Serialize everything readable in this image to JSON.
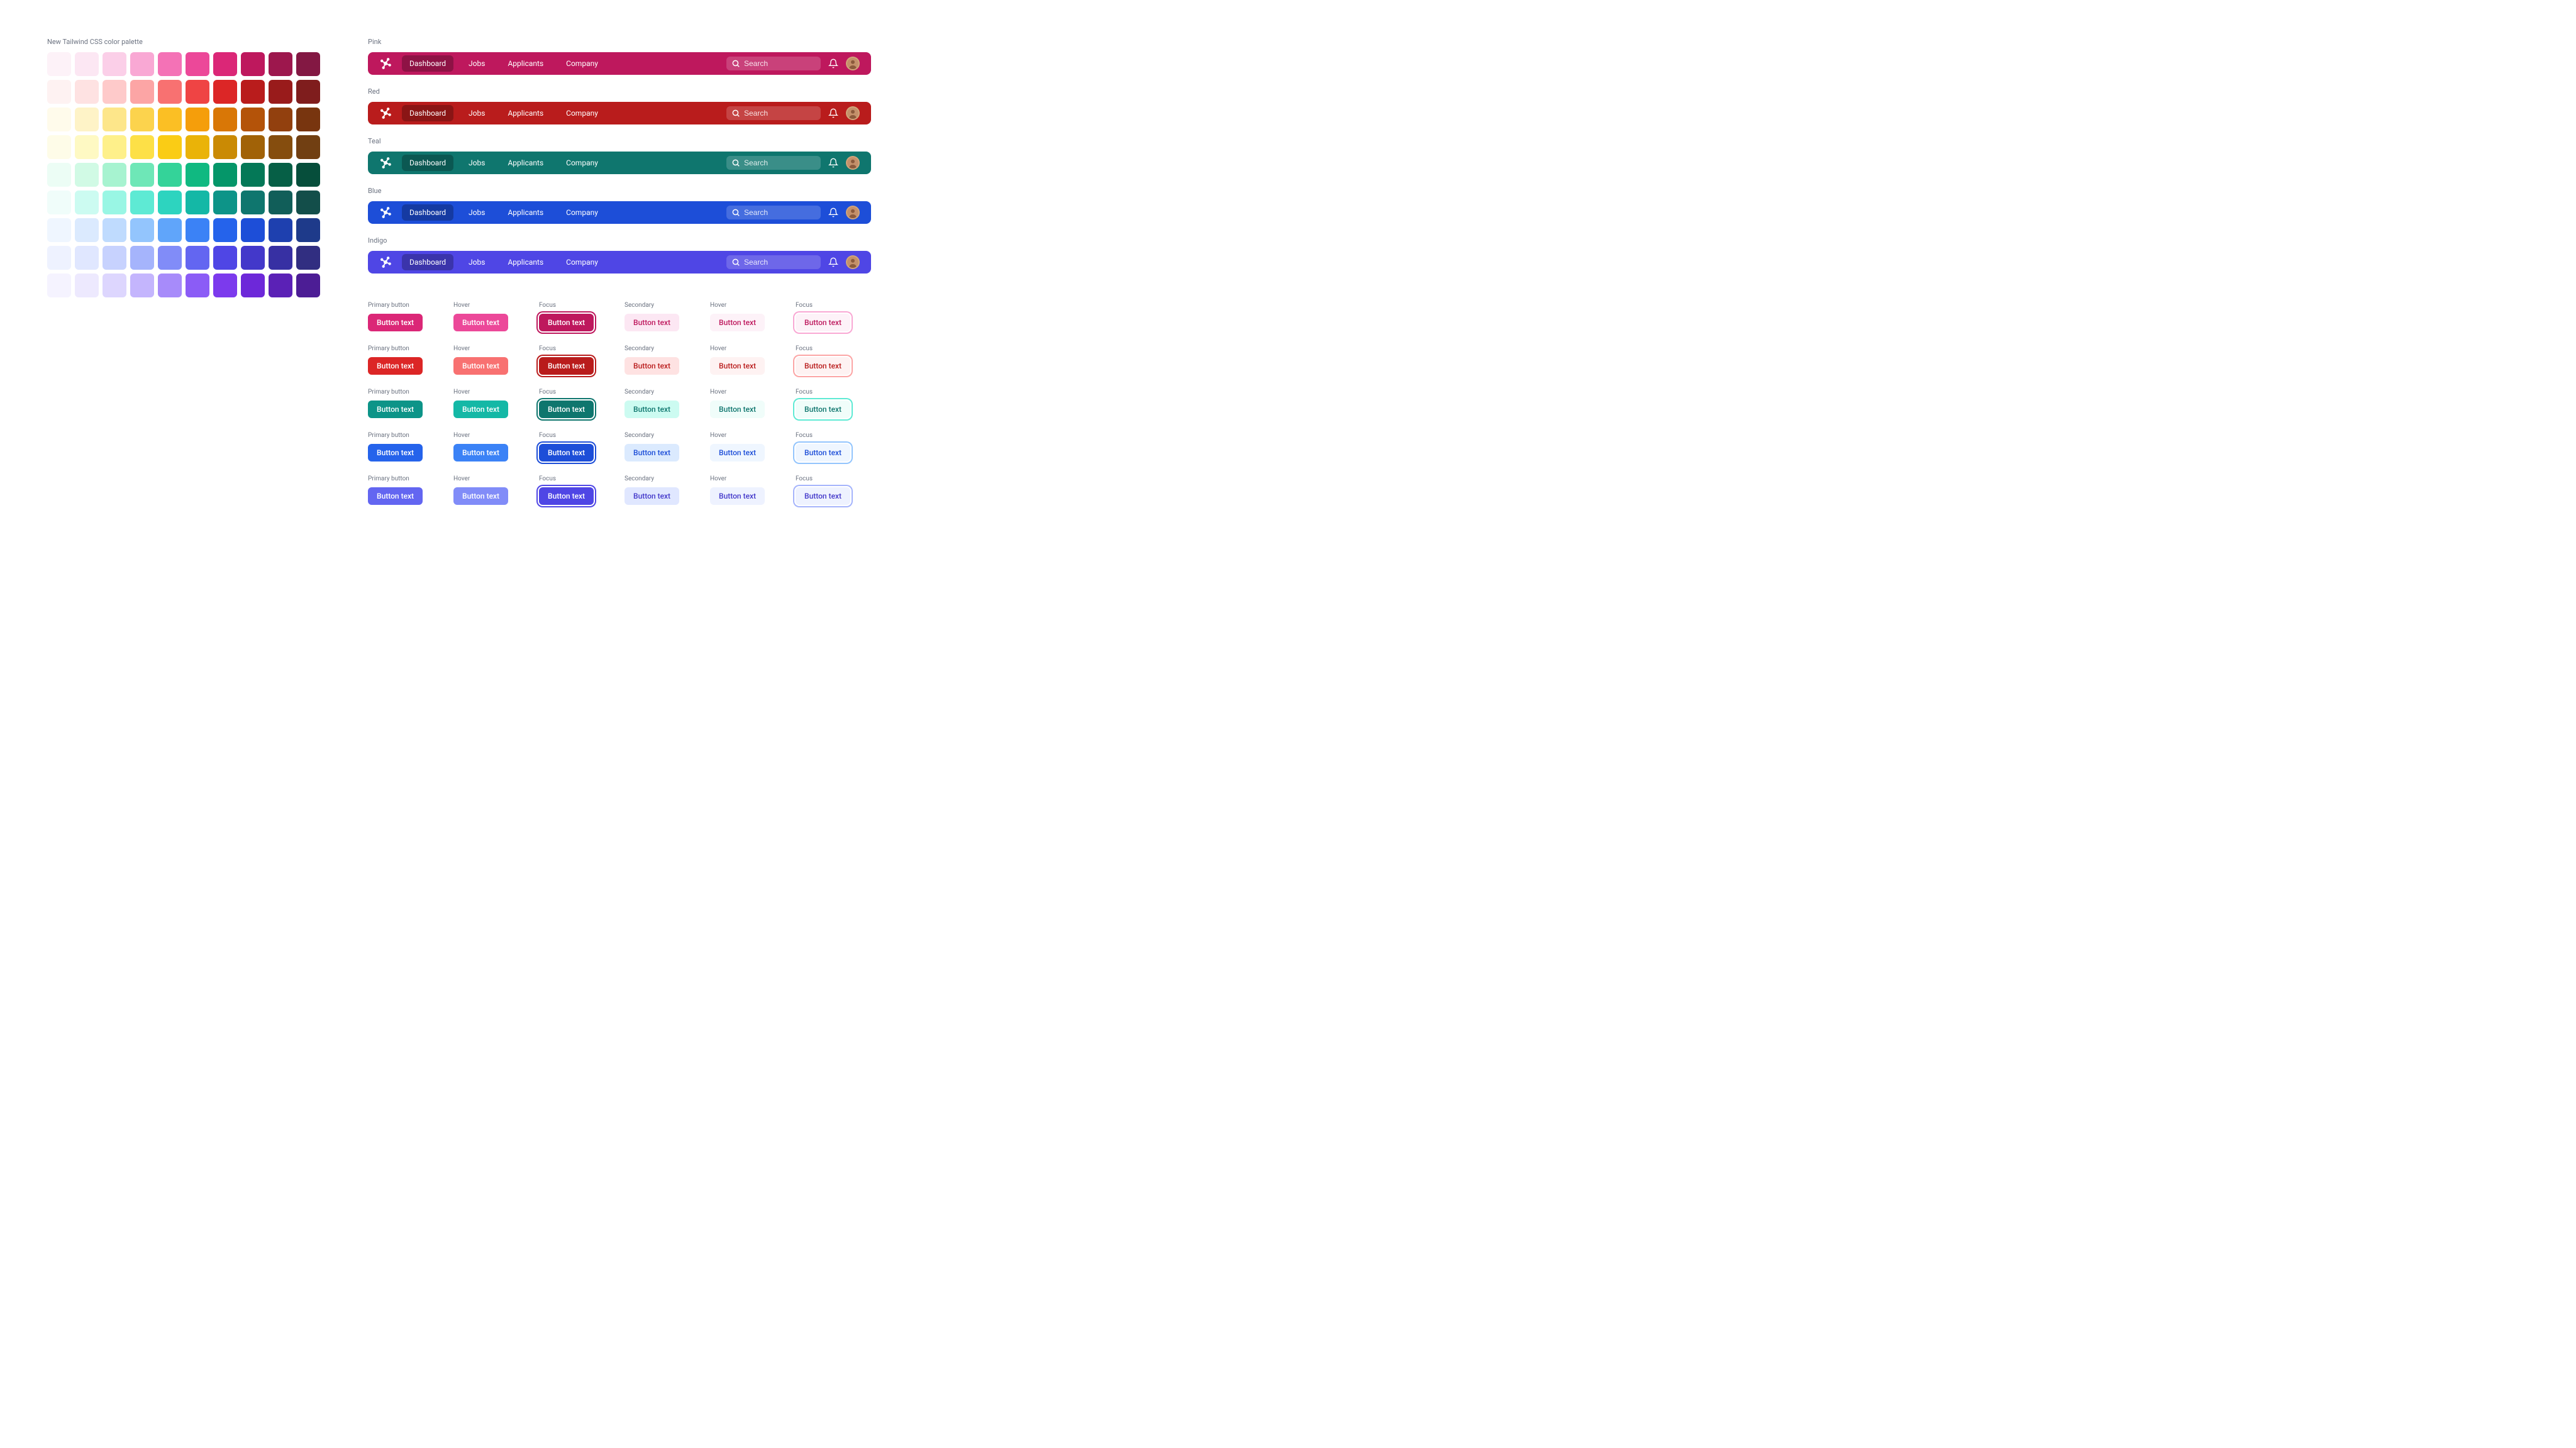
{
  "paletteTitle": "New Tailwind CSS color palette",
  "paletteRows": [
    [
      "#fdf2f8",
      "#fce7f3",
      "#fbcfe8",
      "#f9a8d4",
      "#f472b6",
      "#ec4899",
      "#db2777",
      "#be185d",
      "#9d174d",
      "#831843"
    ],
    [
      "#fef2f2",
      "#fee2e2",
      "#fecaca",
      "#fca5a5",
      "#f87171",
      "#ef4444",
      "#dc2626",
      "#b91c1c",
      "#991b1b",
      "#7f1d1d"
    ],
    [
      "#fffbeb",
      "#fef3c7",
      "#fde68a",
      "#fcd34d",
      "#fbbf24",
      "#f59e0b",
      "#d97706",
      "#b45309",
      "#92400e",
      "#78350f"
    ],
    [
      "#fefce8",
      "#fef9c3",
      "#fef08a",
      "#fde047",
      "#facc15",
      "#eab308",
      "#ca8a04",
      "#a16207",
      "#854d0e",
      "#713f12"
    ],
    [
      "#ecfdf5",
      "#d1fae5",
      "#a7f3d0",
      "#6ee7b7",
      "#34d399",
      "#10b981",
      "#059669",
      "#047857",
      "#065f46",
      "#064e3b"
    ],
    [
      "#f0fdfa",
      "#ccfbf1",
      "#99f6e4",
      "#5eead4",
      "#2dd4bf",
      "#14b8a6",
      "#0d9488",
      "#0f766e",
      "#115e59",
      "#134e4a"
    ],
    [
      "#eff6ff",
      "#dbeafe",
      "#bfdbfe",
      "#93c5fd",
      "#60a5fa",
      "#3b82f6",
      "#2563eb",
      "#1d4ed8",
      "#1e40af",
      "#1e3a8a"
    ],
    [
      "#eef2ff",
      "#e0e7ff",
      "#c7d2fe",
      "#a5b4fc",
      "#818cf8",
      "#6366f1",
      "#4f46e5",
      "#4338ca",
      "#3730a3",
      "#312e81"
    ],
    [
      "#f5f3ff",
      "#ede9fe",
      "#ddd6fe",
      "#c4b5fd",
      "#a78bfa",
      "#8b5cf6",
      "#7c3aed",
      "#6d28d9",
      "#5b21b6",
      "#4c1d95"
    ]
  ],
  "navbars": [
    {
      "label": "Pink",
      "bg": "#be185d"
    },
    {
      "label": "Red",
      "bg": "#b91c1c"
    },
    {
      "label": "Teal",
      "bg": "#0f766e"
    },
    {
      "label": "Blue",
      "bg": "#1d4ed8"
    },
    {
      "label": "Indigo",
      "bg": "#4f46e5"
    }
  ],
  "nav": {
    "items": [
      "Dashboard",
      "Jobs",
      "Applicants",
      "Company"
    ],
    "activeIndex": 0,
    "searchPlaceholder": "Search"
  },
  "buttonStates": [
    {
      "label": "Primary button",
      "kind": "primary"
    },
    {
      "label": "Hover",
      "kind": "primary-hover"
    },
    {
      "label": "Focus",
      "kind": "primary-focus"
    },
    {
      "label": "Secondary",
      "kind": "secondary"
    },
    {
      "label": "Hover",
      "kind": "secondary-hover"
    },
    {
      "label": "Focus",
      "kind": "secondary-focus"
    }
  ],
  "buttonText": "Button text",
  "buttonThemes": [
    {
      "name": "pink",
      "primary": "#db2777",
      "primaryHover": "#ec4899",
      "primaryFocus": "#be185d",
      "secondaryBg": "#fce7f3",
      "secondaryText": "#be185d",
      "secondaryHoverBg": "#fdf2f8",
      "ring": "#f9a8d4"
    },
    {
      "name": "red",
      "primary": "#dc2626",
      "primaryHover": "#f87171",
      "primaryFocus": "#b91c1c",
      "secondaryBg": "#fee2e2",
      "secondaryText": "#b91c1c",
      "secondaryHoverBg": "#fef2f2",
      "ring": "#fca5a5"
    },
    {
      "name": "teal",
      "primary": "#0d9488",
      "primaryHover": "#14b8a6",
      "primaryFocus": "#0f766e",
      "secondaryBg": "#ccfbf1",
      "secondaryText": "#0f766e",
      "secondaryHoverBg": "#f0fdfa",
      "ring": "#5eead4"
    },
    {
      "name": "blue",
      "primary": "#2563eb",
      "primaryHover": "#3b82f6",
      "primaryFocus": "#1d4ed8",
      "secondaryBg": "#dbeafe",
      "secondaryText": "#1d4ed8",
      "secondaryHoverBg": "#eff6ff",
      "ring": "#93c5fd"
    },
    {
      "name": "indigo",
      "primary": "#6366f1",
      "primaryHover": "#818cf8",
      "primaryFocus": "#4f46e5",
      "secondaryBg": "#e0e7ff",
      "secondaryText": "#4338ca",
      "secondaryHoverBg": "#eef2ff",
      "ring": "#a5b4fc"
    }
  ]
}
